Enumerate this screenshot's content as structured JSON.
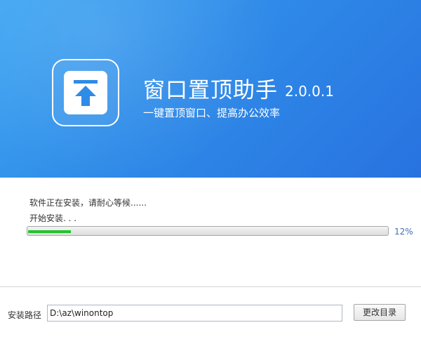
{
  "header": {
    "app_name": "窗口置顶助手",
    "version": "2.0.0.1",
    "tagline": "一键置顶窗口、提高办公效率",
    "logo_icon": "pin-to-top-icon"
  },
  "install": {
    "status_text": "软件正在安装，请耐心等候......",
    "step_text": "开始安装. . .",
    "progress_percent": 12,
    "progress_label": "12%",
    "progress_color": "#22c52b"
  },
  "footer": {
    "path_label": "安装路径",
    "path_value": "D:\\az\\winontop",
    "change_button": "更改目录"
  },
  "colors": {
    "header_blue": "#2f8be8",
    "percent_text": "#3b6fb6"
  }
}
